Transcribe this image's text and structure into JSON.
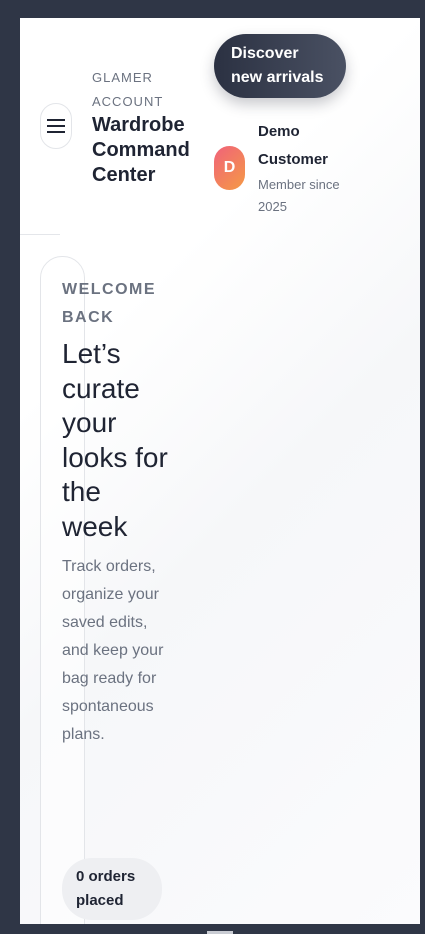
{
  "header": {
    "eyebrow": "GLAMER ACCOUNT",
    "title": "Wardrobe Command Center",
    "menu_icon": "hamburger-icon"
  },
  "cta": {
    "discover_label": "Discover new arrivals"
  },
  "user": {
    "initial": "D",
    "name": "Demo Customer",
    "since": "Member since 2025"
  },
  "hero": {
    "eyebrow": "WELCOME BACK",
    "title": "Let’s curate your looks for the week",
    "text": "Track orders, organize your saved edits, and keep your bag ready for spontaneous plans."
  },
  "stats": {
    "orders_label": "0 orders placed"
  },
  "colors": {
    "background": "#2f3646",
    "accent_dark": "#2b3142",
    "avatar_gradient_start": "#f0627a",
    "avatar_gradient_end": "#f59a45"
  }
}
